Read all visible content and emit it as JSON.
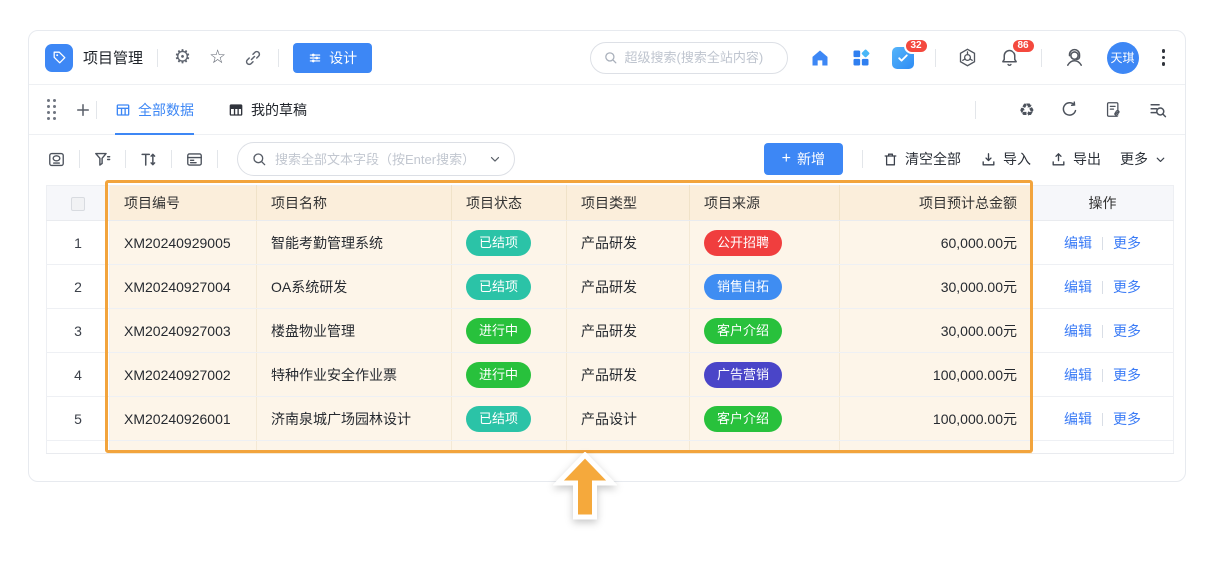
{
  "header": {
    "app_title": "项目管理",
    "design_button": "设计",
    "global_search_placeholder": "超级搜索(搜索全站内容)",
    "task_badge": "32",
    "notification_badge": "86",
    "avatar_name": "天琪"
  },
  "tabs": {
    "items": [
      {
        "label": "全部数据",
        "active": true
      },
      {
        "label": "我的草稿",
        "active": false
      }
    ]
  },
  "toolbar": {
    "search_placeholder": "搜索全部文本字段（按Enter搜索）",
    "add_button": "新增",
    "clear_button": "清空全部",
    "import_button": "导入",
    "export_button": "导出",
    "more_button": "更多"
  },
  "table": {
    "columns": [
      "项目编号",
      "项目名称",
      "项目状态",
      "项目类型",
      "项目来源",
      "项目预计总金额",
      "操作"
    ],
    "rows": [
      {
        "index": "1",
        "code": "XM20240929005",
        "name": "智能考勤管理系统",
        "status": "已结项",
        "type": "产品研发",
        "source": "公开招聘",
        "amount": "60,000.00元"
      },
      {
        "index": "2",
        "code": "XM20240927004",
        "name": "OA系统研发",
        "status": "已结项",
        "type": "产品研发",
        "source": "销售自拓",
        "amount": "30,000.00元"
      },
      {
        "index": "3",
        "code": "XM20240927003",
        "name": "楼盘物业管理",
        "status": "进行中",
        "type": "产品研发",
        "source": "客户介绍",
        "amount": "30,000.00元"
      },
      {
        "index": "4",
        "code": "XM20240927002",
        "name": "特种作业安全作业票",
        "status": "进行中",
        "type": "产品研发",
        "source": "广告营销",
        "amount": "100,000.00元"
      },
      {
        "index": "5",
        "code": "XM20240926001",
        "name": "济南泉城广场园林设计",
        "status": "已结项",
        "type": "产品设计",
        "source": "客户介绍",
        "amount": "100,000.00元"
      }
    ],
    "edit_label": "编辑",
    "row_more_label": "更多",
    "pill_colors": {
      "已结项": "#2bc3a7",
      "进行中": "#28c13c",
      "公开招聘": "#f03e3e",
      "销售自拓": "#3f8df2",
      "客户介绍": "#28c13c",
      "广告营销": "#4a45c8"
    }
  },
  "colors": {
    "accent": "#3d87f5",
    "highlight": "#f2a43d",
    "badge": "#f4493e"
  }
}
